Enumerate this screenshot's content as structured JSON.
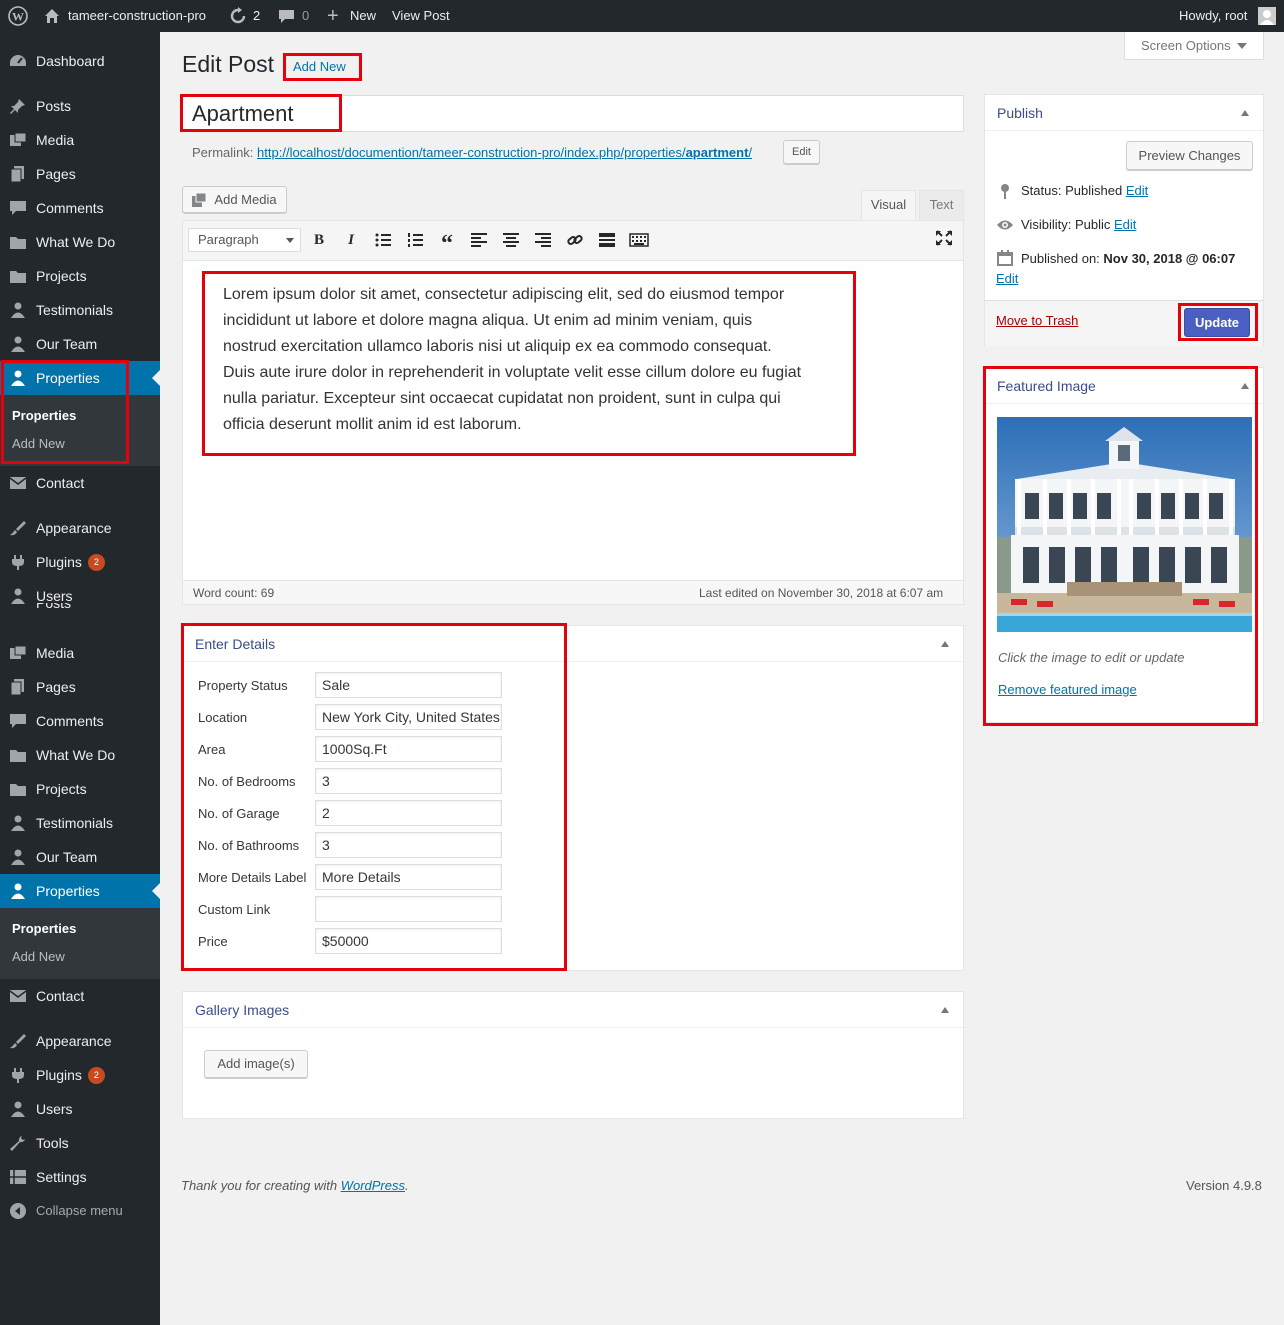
{
  "admin_bar": {
    "site_name": "tameer-construction-pro",
    "updates_count": "2",
    "comments_count": "0",
    "new_label": "New",
    "view_post_label": "View Post",
    "howdy": "Howdy, root"
  },
  "menu": {
    "dashboard": "Dashboard",
    "posts": "Posts",
    "media": "Media",
    "pages": "Pages",
    "comments": "Comments",
    "what_we_do": "What We Do",
    "projects": "Projects",
    "testimonials": "Testimonials",
    "our_team": "Our Team",
    "properties": "Properties",
    "sub_properties": "Properties",
    "sub_add_new": "Add New",
    "contact": "Contact",
    "appearance": "Appearance",
    "plugins": "Plugins",
    "plugins_badge": "2",
    "users": "Users",
    "tools": "Tools",
    "settings": "Settings",
    "collapse": "Collapse menu"
  },
  "header": {
    "title": "Edit Post",
    "add_new": "Add New",
    "screen_options": "Screen Options"
  },
  "post": {
    "title": "Apartment",
    "permalink_label": "Permalink:",
    "permalink_base": "http://localhost/documention/tameer-construction-pro/index.php/properties/",
    "permalink_slug": "apartment",
    "permalink_suffix": "/",
    "edit_label": "Edit",
    "add_media": "Add Media",
    "tab_visual": "Visual",
    "tab_text": "Text",
    "format_select": "Paragraph",
    "content_lines": [
      "Lorem ipsum dolor sit amet, consectetur adipiscing elit, sed do eiusmod tempor",
      "incididunt ut labore et dolore magna aliqua. Ut enim ad minim veniam, quis",
      "nostrud exercitation ullamco laboris nisi ut aliquip ex ea commodo consequat.",
      "Duis aute irure dolor in reprehenderit in voluptate velit esse cillum dolore eu fugiat",
      "nulla pariatur. Excepteur sint occaecat cupidatat non proident, sunt in culpa qui",
      "officia deserunt mollit anim id est laborum."
    ],
    "word_count": "Word count: 69",
    "last_edited": "Last edited on November 30, 2018 at 6:07 am"
  },
  "details": {
    "title": "Enter Details",
    "fields": [
      {
        "label": "Property Status",
        "value": "Sale"
      },
      {
        "label": "Location",
        "value": "New York City, United States"
      },
      {
        "label": "Area",
        "value": "1000Sq.Ft"
      },
      {
        "label": "No. of Bedrooms",
        "value": "3"
      },
      {
        "label": "No. of Garage",
        "value": "2"
      },
      {
        "label": "No. of Bathrooms",
        "value": "3"
      },
      {
        "label": "More Details Label",
        "value": "More Details"
      },
      {
        "label": "Custom Link",
        "value": ""
      },
      {
        "label": "Price",
        "value": "$50000"
      }
    ]
  },
  "gallery": {
    "title": "Gallery Images",
    "add_button": "Add image(s)"
  },
  "publish": {
    "title": "Publish",
    "preview": "Preview Changes",
    "status_label": "Status:",
    "status_value": "Published",
    "visibility_label": "Visibility:",
    "visibility_value": "Public",
    "published_label": "Published on:",
    "published_value": "Nov 30, 2018 @ 06:07",
    "edit": "Edit",
    "trash": "Move to Trash",
    "update": "Update"
  },
  "featured": {
    "title": "Featured Image",
    "hint": "Click the image to edit or update",
    "remove": "Remove featured image"
  },
  "footer": {
    "thanks_prefix": "Thank you for creating with ",
    "wordpress": "WordPress",
    "thanks_suffix": ".",
    "version": "Version 4.9.8"
  },
  "colors": {
    "accent": "#0073aa",
    "highlight": "#e5000b",
    "sidebar": "#23282d",
    "update_button": "#4a5fc1"
  }
}
